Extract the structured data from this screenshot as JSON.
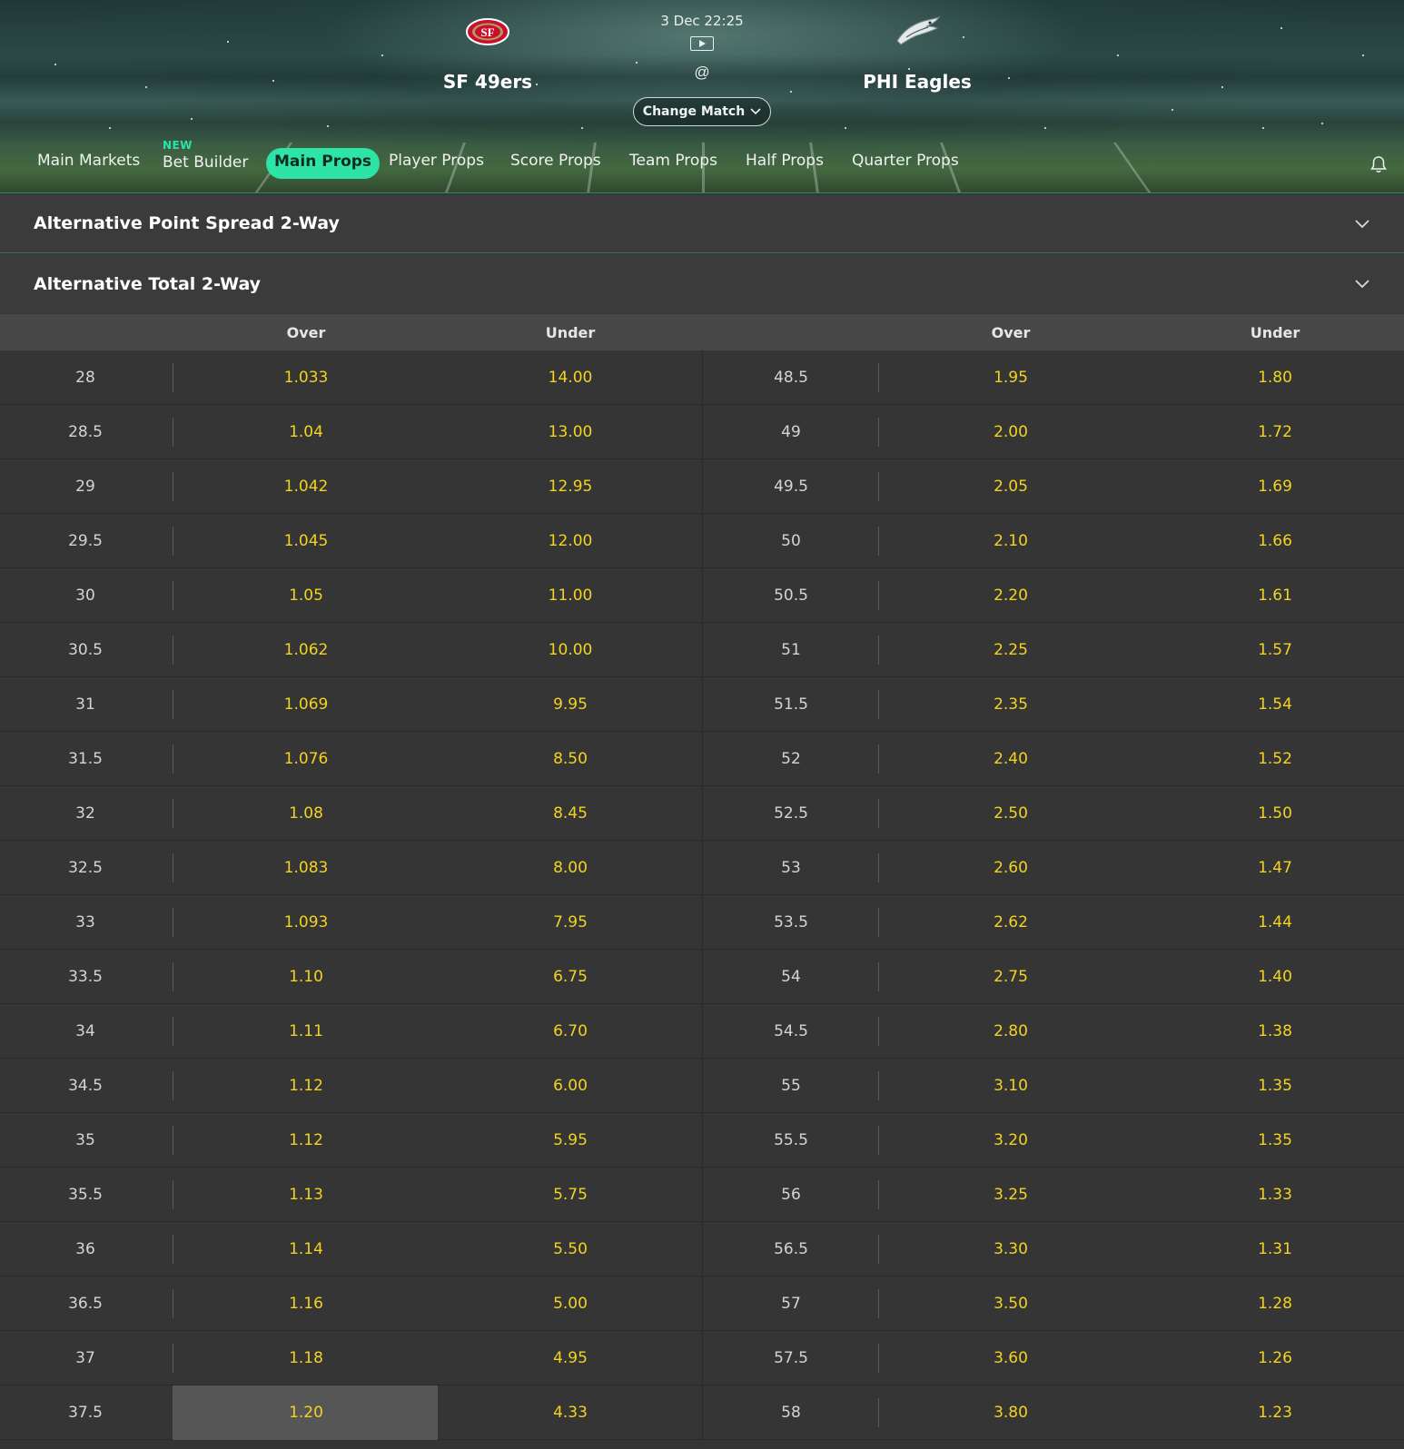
{
  "match": {
    "home_team": "SF 49ers",
    "away_team": "PHI Eagles",
    "datetime": "3 Dec 22:25",
    "separator": "@",
    "change_match_label": "Change Match",
    "home_logo_icon": "49ers-logo-icon",
    "away_logo_icon": "eagles-logo-icon"
  },
  "tabs": [
    {
      "label": "Main Markets",
      "active": false
    },
    {
      "label": "Bet Builder",
      "active": false,
      "badge": "NEW"
    },
    {
      "label": "Main Props",
      "active": true
    },
    {
      "label": "Player Props",
      "active": false
    },
    {
      "label": "Score Props",
      "active": false
    },
    {
      "label": "Team Props",
      "active": false
    },
    {
      "label": "Half Props",
      "active": false
    },
    {
      "label": "Quarter Props",
      "active": false
    }
  ],
  "markets": [
    {
      "title": "Alternative Point Spread 2-Way",
      "expanded": false
    },
    {
      "title": "Alternative Total 2-Way",
      "expanded": true
    }
  ],
  "table": {
    "headers": [
      "Over",
      "Under",
      "Over",
      "Under"
    ],
    "left": [
      [
        "28",
        "1.033",
        "14.00"
      ],
      [
        "28.5",
        "1.04",
        "13.00"
      ],
      [
        "29",
        "1.042",
        "12.95"
      ],
      [
        "29.5",
        "1.045",
        "12.00"
      ],
      [
        "30",
        "1.05",
        "11.00"
      ],
      [
        "30.5",
        "1.062",
        "10.00"
      ],
      [
        "31",
        "1.069",
        "9.95"
      ],
      [
        "31.5",
        "1.076",
        "8.50"
      ],
      [
        "32",
        "1.08",
        "8.45"
      ],
      [
        "32.5",
        "1.083",
        "8.00"
      ],
      [
        "33",
        "1.093",
        "7.95"
      ],
      [
        "33.5",
        "1.10",
        "6.75"
      ],
      [
        "34",
        "1.11",
        "6.70"
      ],
      [
        "34.5",
        "1.12",
        "6.00"
      ],
      [
        "35",
        "1.12",
        "5.95"
      ],
      [
        "35.5",
        "1.13",
        "5.75"
      ],
      [
        "36",
        "1.14",
        "5.50"
      ],
      [
        "36.5",
        "1.16",
        "5.00"
      ],
      [
        "37",
        "1.18",
        "4.95"
      ],
      [
        "37.5",
        "1.20",
        "4.33"
      ]
    ],
    "right": [
      [
        "48.5",
        "1.95",
        "1.80"
      ],
      [
        "49",
        "2.00",
        "1.72"
      ],
      [
        "49.5",
        "2.05",
        "1.69"
      ],
      [
        "50",
        "2.10",
        "1.66"
      ],
      [
        "50.5",
        "2.20",
        "1.61"
      ],
      [
        "51",
        "2.25",
        "1.57"
      ],
      [
        "51.5",
        "2.35",
        "1.54"
      ],
      [
        "52",
        "2.40",
        "1.52"
      ],
      [
        "52.5",
        "2.50",
        "1.50"
      ],
      [
        "53",
        "2.60",
        "1.47"
      ],
      [
        "53.5",
        "2.62",
        "1.44"
      ],
      [
        "54",
        "2.75",
        "1.40"
      ],
      [
        "54.5",
        "2.80",
        "1.38"
      ],
      [
        "55",
        "3.10",
        "1.35"
      ],
      [
        "55.5",
        "3.20",
        "1.35"
      ],
      [
        "56",
        "3.25",
        "1.33"
      ],
      [
        "56.5",
        "3.30",
        "1.31"
      ],
      [
        "57",
        "3.50",
        "1.28"
      ],
      [
        "57.5",
        "3.60",
        "1.26"
      ],
      [
        "58",
        "3.80",
        "1.23"
      ]
    ],
    "highlighted_cell": {
      "row": 19,
      "side": "left",
      "column": "Over"
    }
  },
  "colors": {
    "accent": "#2ee3a6",
    "odds": "#f3d31f",
    "background": "#343434"
  }
}
